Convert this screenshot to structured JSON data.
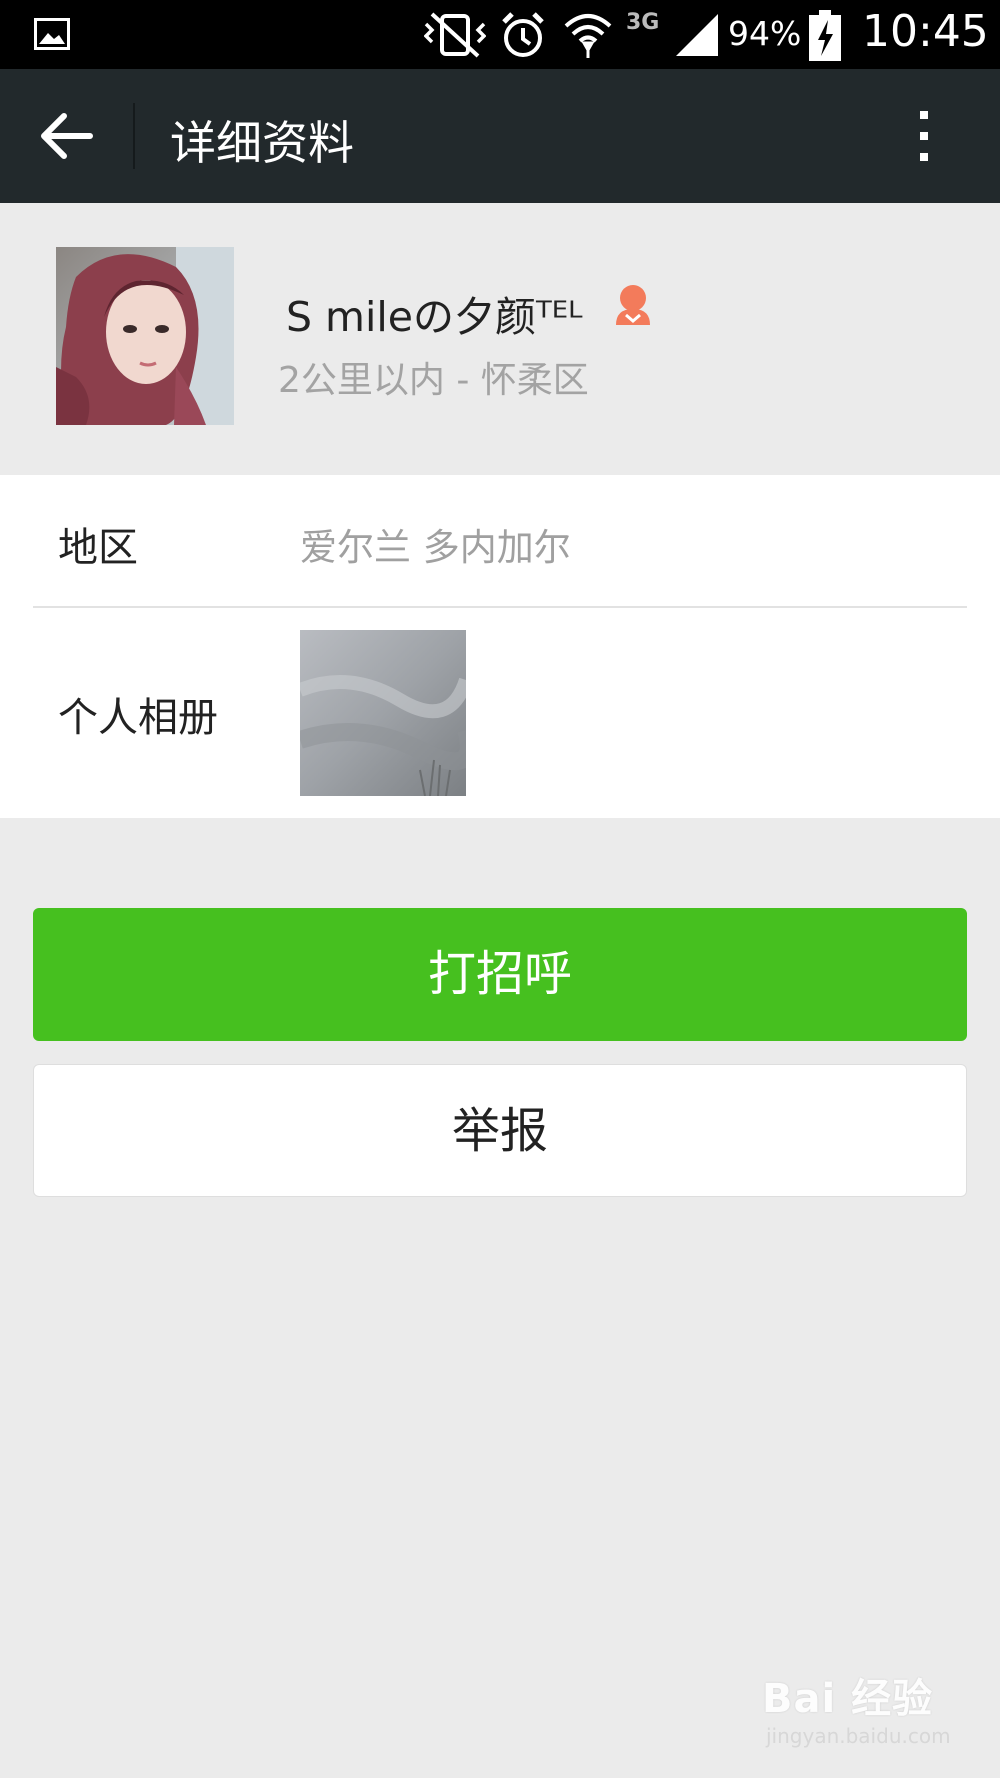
{
  "status_bar": {
    "icons": [
      "gallery-notification-icon",
      "vibrate-icon",
      "alarm-icon",
      "wifi-icon",
      "signal-icon",
      "battery-charging-icon"
    ],
    "network_type": "3G",
    "battery_percent": "94%",
    "time": "10:45"
  },
  "header": {
    "back_icon": "back-arrow-icon",
    "title": "详细资料",
    "menu_icon": "more-vertical-icon"
  },
  "profile": {
    "nickname": "S mileの夕颜ᵀᴱᴸ",
    "gender": "female",
    "gender_icon": "female-icon",
    "distance_location": "2公里以内 - 怀柔区"
  },
  "info": {
    "region_label": "地区",
    "region_value": "爱尔兰  多内加尔",
    "album_label": "个人相册"
  },
  "actions": {
    "greet_label": "打招呼",
    "report_label": "举报"
  },
  "watermark": {
    "main": "Bai 经验",
    "url": "jingyan.baidu.com"
  },
  "colors": {
    "titlebar": "#22292c",
    "primary_button": "#46c01f",
    "page_background": "#ebebeb",
    "gender_icon": "#f37b5b"
  }
}
